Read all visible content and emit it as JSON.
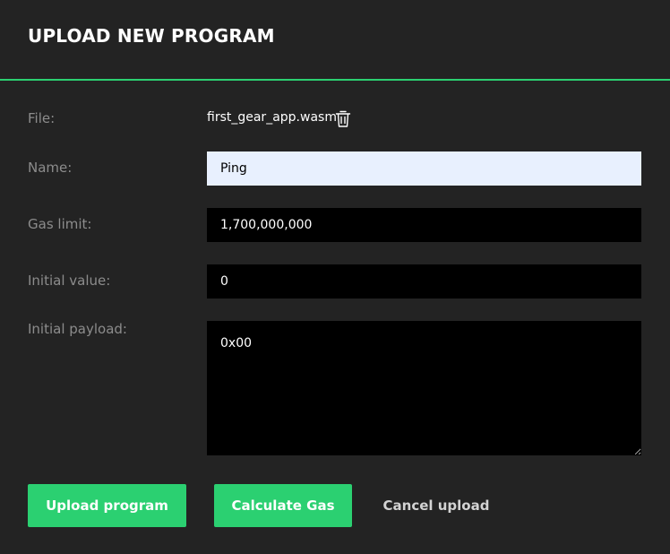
{
  "dialog": {
    "title": "UPLOAD NEW PROGRAM"
  },
  "form": {
    "file": {
      "label": "File:",
      "value": "first_gear_app.wasm",
      "remove_icon": "trash-icon"
    },
    "name": {
      "label": "Name:",
      "value": "Ping"
    },
    "gas_limit": {
      "label": "Gas limit:",
      "value": "1,700,000,000"
    },
    "initial_value": {
      "label": "Initial value:",
      "value": "0"
    },
    "initial_payload": {
      "label": "Initial payload:",
      "value": "0x00"
    }
  },
  "actions": {
    "upload_label": "Upload program",
    "calculate_label": "Calculate Gas",
    "cancel_label": "Cancel upload"
  },
  "colors": {
    "background": "#232323",
    "accent": "#2bd071",
    "label": "#8c8c8c",
    "input_background": "#000000",
    "autofill_background": "#e8f0fe"
  }
}
